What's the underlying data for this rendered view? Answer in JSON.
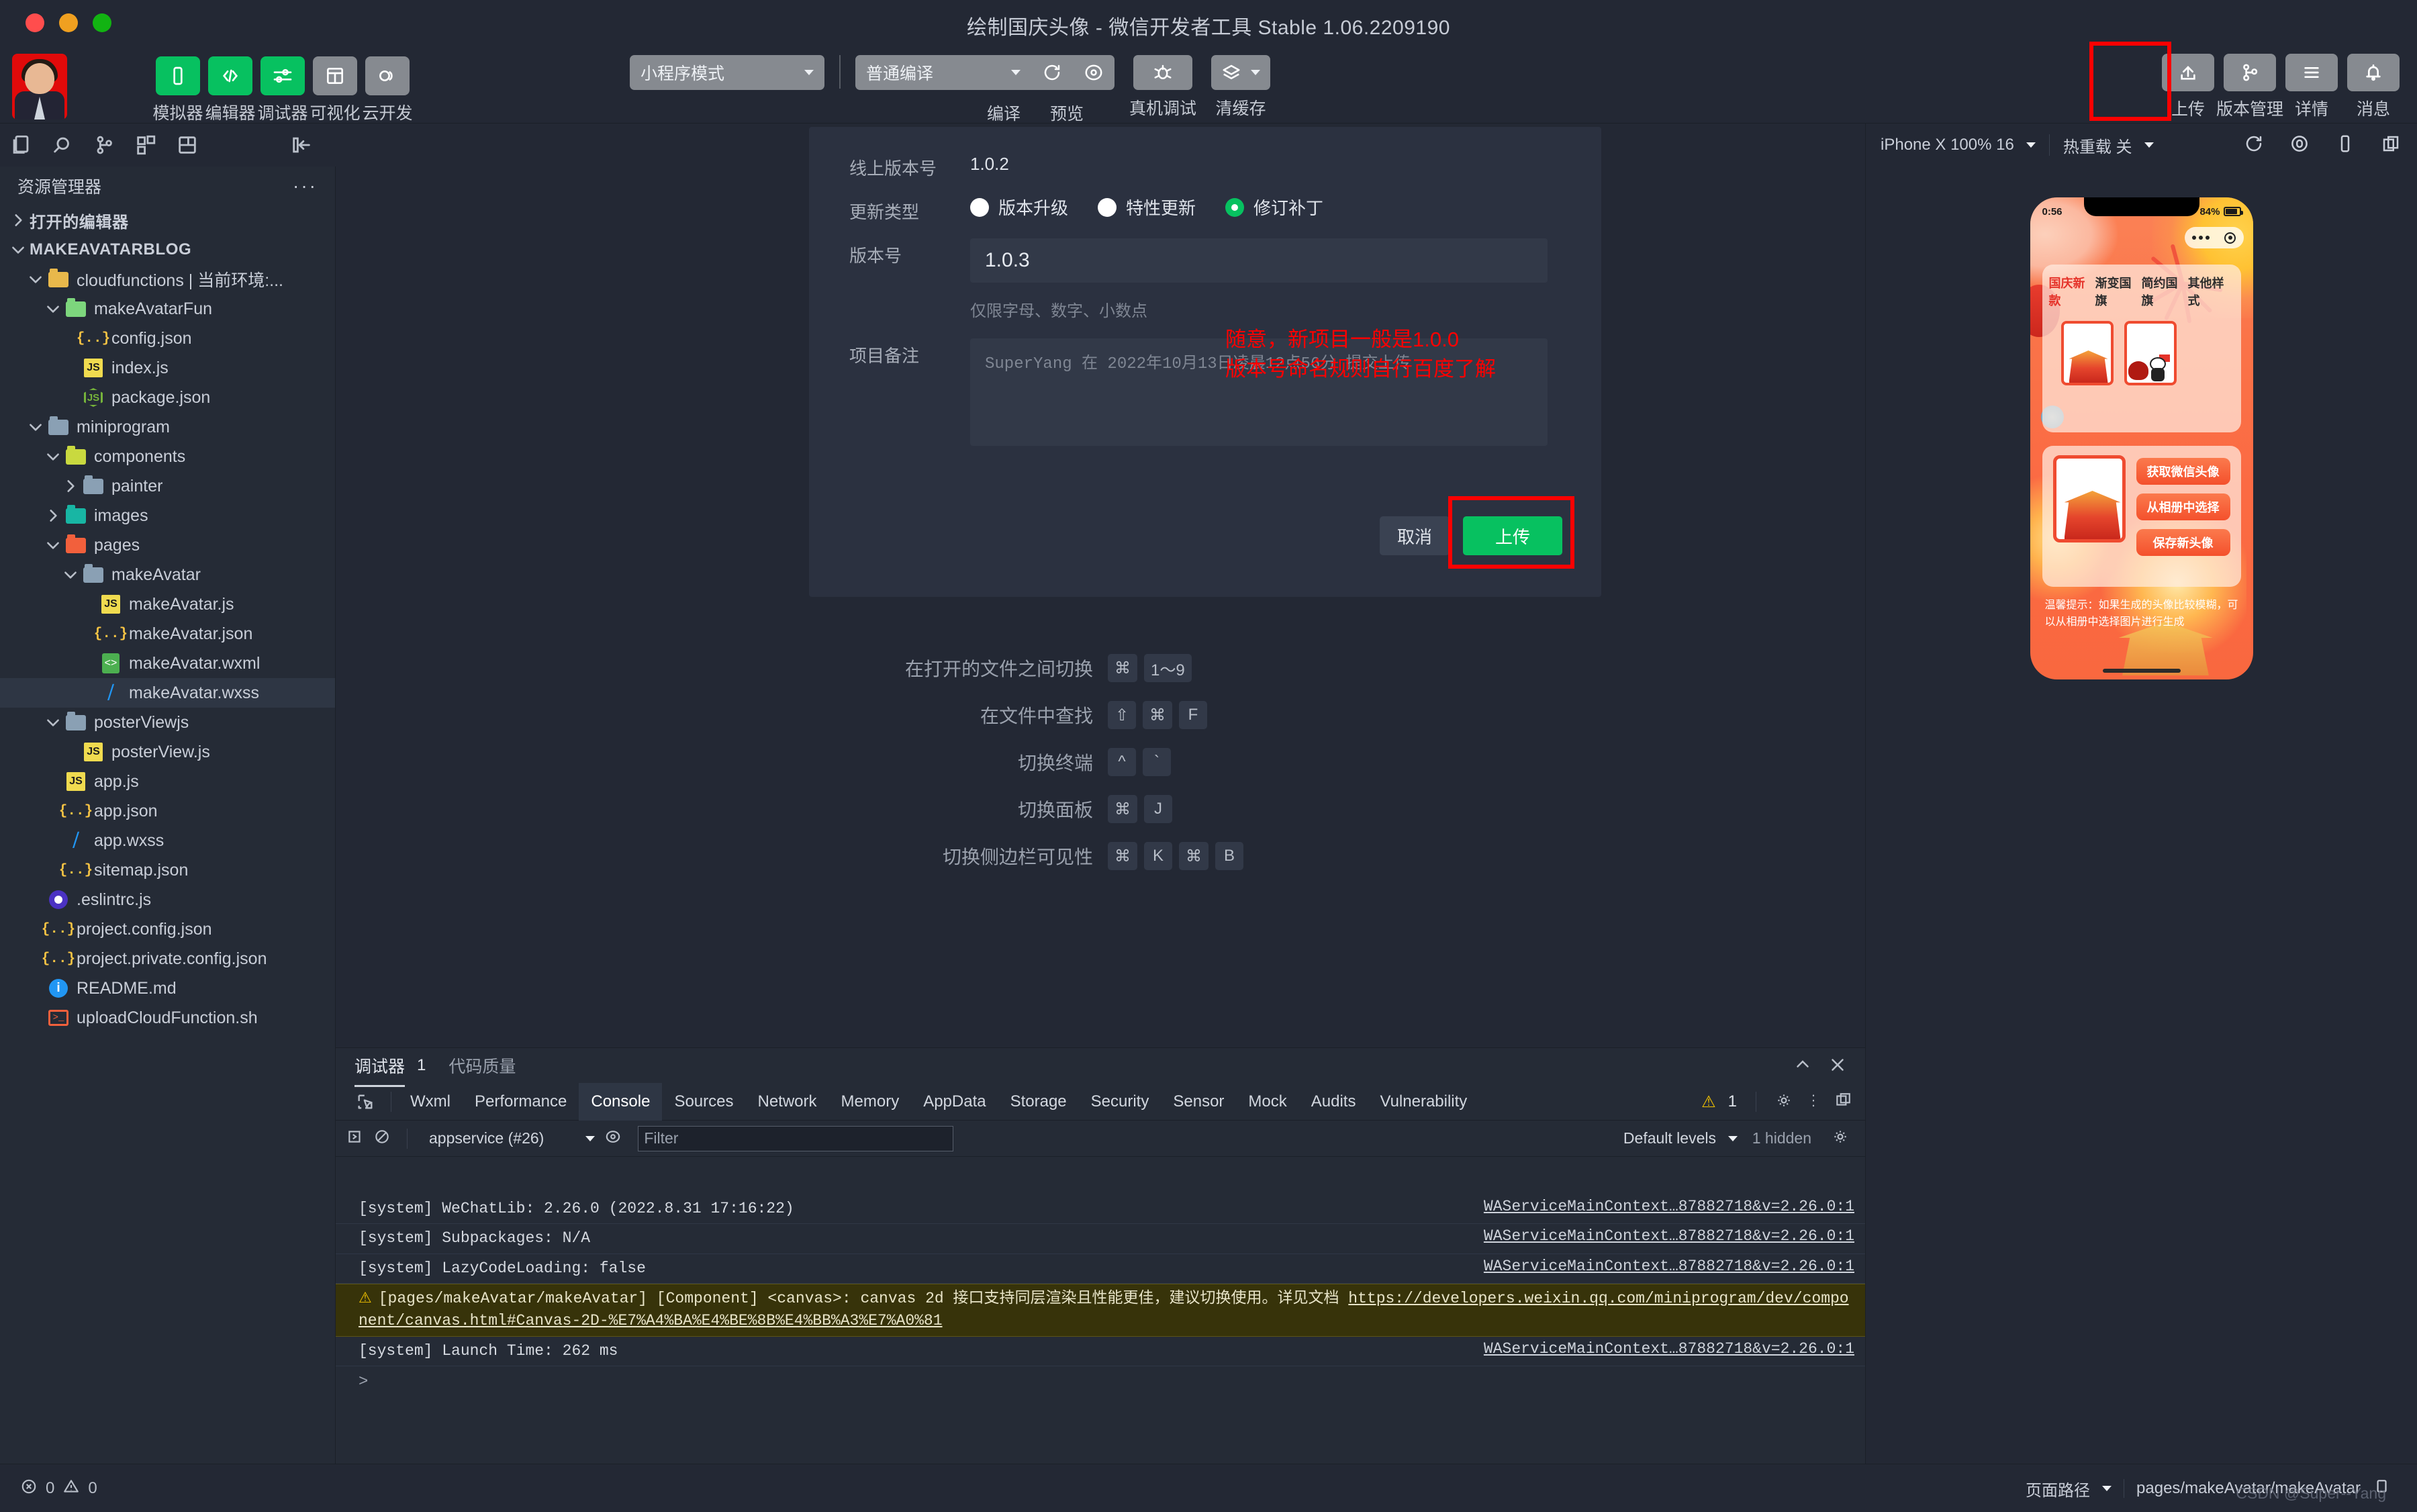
{
  "window": {
    "title": "绘制国庆头像 - 微信开发者工具 Stable 1.06.2209190"
  },
  "toolbar": {
    "left_items": [
      {
        "label": "模拟器",
        "icon": "phone-icon",
        "style": "green"
      },
      {
        "label": "编辑器",
        "icon": "code-icon",
        "style": "green"
      },
      {
        "label": "调试器",
        "icon": "sliders-icon",
        "style": "green"
      },
      {
        "label": "可视化",
        "icon": "layout-icon",
        "style": "grey"
      },
      {
        "label": "云开发",
        "icon": "cloud-icon",
        "style": "grey"
      }
    ],
    "mode_select": "小程序模式",
    "compile_select": "普通编译",
    "compile_label": "编译",
    "preview_label": "预览",
    "realdevice_label": "真机调试",
    "clearcache_label": "清缓存",
    "right_items": [
      {
        "label": "上传",
        "icon": "upload-icon"
      },
      {
        "label": "版本管理",
        "icon": "branch-icon"
      },
      {
        "label": "详情",
        "icon": "hamburger-icon"
      },
      {
        "label": "消息",
        "icon": "bell-icon"
      }
    ]
  },
  "activitybar": {
    "icons": [
      "files-icon",
      "search-icon",
      "source-control-icon",
      "extensions-icon",
      "layout-panel-icon",
      "collapse-sidebar-icon"
    ]
  },
  "explorer": {
    "title": "资源管理器",
    "more": "···",
    "open_editors": "打开的编辑器",
    "project": "MAKEAVATARBLOG",
    "tree": [
      {
        "name": "cloudfunctions | 当前环境:...",
        "indent": 1,
        "type": "folder-cloud",
        "chev": "down"
      },
      {
        "name": "makeAvatarFun",
        "indent": 2,
        "type": "folder-fn",
        "chev": "down"
      },
      {
        "name": "config.json",
        "indent": 3,
        "type": "json",
        "chev": "none"
      },
      {
        "name": "index.js",
        "indent": 3,
        "type": "js",
        "chev": "none"
      },
      {
        "name": "package.json",
        "indent": 3,
        "type": "node",
        "chev": "none"
      },
      {
        "name": "miniprogram",
        "indent": 1,
        "type": "folder",
        "chev": "down"
      },
      {
        "name": "components",
        "indent": 2,
        "type": "folder-comp",
        "chev": "down"
      },
      {
        "name": "painter",
        "indent": 3,
        "type": "folder",
        "chev": "right"
      },
      {
        "name": "images",
        "indent": 2,
        "type": "folder-img",
        "chev": "right"
      },
      {
        "name": "pages",
        "indent": 2,
        "type": "folder-pages",
        "chev": "down"
      },
      {
        "name": "makeAvatar",
        "indent": 3,
        "type": "folder",
        "chev": "down"
      },
      {
        "name": "makeAvatar.js",
        "indent": 4,
        "type": "js",
        "chev": "none"
      },
      {
        "name": "makeAvatar.json",
        "indent": 4,
        "type": "json",
        "chev": "none"
      },
      {
        "name": "makeAvatar.wxml",
        "indent": 4,
        "type": "wxml",
        "chev": "none"
      },
      {
        "name": "makeAvatar.wxss",
        "indent": 4,
        "type": "wxss",
        "chev": "none",
        "selected": true
      },
      {
        "name": "posterViewjs",
        "indent": 2,
        "type": "folder",
        "chev": "down"
      },
      {
        "name": "posterView.js",
        "indent": 3,
        "type": "js",
        "chev": "none"
      },
      {
        "name": "app.js",
        "indent": 2,
        "type": "js",
        "chev": "none"
      },
      {
        "name": "app.json",
        "indent": 2,
        "type": "json",
        "chev": "none"
      },
      {
        "name": "app.wxss",
        "indent": 2,
        "type": "wxss",
        "chev": "none"
      },
      {
        "name": "sitemap.json",
        "indent": 2,
        "type": "json",
        "chev": "none"
      },
      {
        "name": ".eslintrc.js",
        "indent": 1,
        "type": "eslint",
        "chev": "none"
      },
      {
        "name": "project.config.json",
        "indent": 1,
        "type": "json",
        "chev": "none"
      },
      {
        "name": "project.private.config.json",
        "indent": 1,
        "type": "json",
        "chev": "none"
      },
      {
        "name": "README.md",
        "indent": 1,
        "type": "md",
        "chev": "none"
      },
      {
        "name": "uploadCloudFunction.sh",
        "indent": 1,
        "type": "sh",
        "chev": "none"
      }
    ]
  },
  "dialog": {
    "online_version_label": "线上版本号",
    "online_version_value": "1.0.2",
    "update_type_label": "更新类型",
    "update_types": [
      {
        "label": "版本升级",
        "selected": false
      },
      {
        "label": "特性更新",
        "selected": false
      },
      {
        "label": "修订补丁",
        "selected": true
      }
    ],
    "version_label": "版本号",
    "version_value": "1.0.3",
    "version_hint": "仅限字母、数字、小数点",
    "memo_label": "项目备注",
    "memo_placeholder": "SuperYang 在 2022年10月13日凌晨12点56分 提交上传",
    "cancel_label": "取消",
    "upload_label": "上传",
    "annotation_line1": "随意，新项目一般是1.0.0",
    "annotation_line2": "版本号命名规则自行百度了解",
    "annotation_color": "#ff0000"
  },
  "shortcuts": [
    {
      "label": "在打开的文件之间切换",
      "keys": [
        "⌘",
        "1～9"
      ]
    },
    {
      "label": "在文件中查找",
      "keys": [
        "⇧",
        "⌘",
        "F"
      ]
    },
    {
      "label": "切换终端",
      "keys": [
        "^",
        "`"
      ]
    },
    {
      "label": "切换面板",
      "keys": [
        "⌘",
        "J"
      ]
    },
    {
      "label": "切换侧边栏可见性",
      "keys": [
        "⌘",
        "K",
        "⌘",
        "B"
      ]
    }
  ],
  "console": {
    "panel_tab": "调试器",
    "panel_badge": "1",
    "panel_tab_alt": "代码质量",
    "devtools_tabs": [
      "Wxml",
      "Performance",
      "Console",
      "Sources",
      "Network",
      "Memory",
      "AppData",
      "Storage",
      "Security",
      "Sensor",
      "Mock",
      "Audits",
      "Vulnerability"
    ],
    "active_tab": "Console",
    "warning_count": "1",
    "context": "appservice (#26)",
    "filter_placeholder": "Filter",
    "levels": "Default levels",
    "hidden_count": "1 hidden",
    "prompt": ">",
    "logs": [
      {
        "text": "[system] WeChatLib: 2.26.0 (2022.8.31 17:16:22)",
        "source": "WAServiceMainContext…87882718&v=2.26.0:1",
        "level": "info"
      },
      {
        "text": "[system] Subpackages: N/A",
        "source": "WAServiceMainContext…87882718&v=2.26.0:1",
        "level": "info"
      },
      {
        "text": "[system] LazyCodeLoading: false",
        "source": "WAServiceMainContext…87882718&v=2.26.0:1",
        "level": "info"
      },
      {
        "text": "[pages/makeAvatar/makeAvatar] [Component] <canvas>: canvas 2d 接口支持同层渲染且性能更佳，建议切换使用。详见文档 ",
        "link": "https://developers.weixin.qq.com/miniprogram/dev/component/canvas.html#Canvas-2D-%E7%A4%BA%E4%BE%8B%E4%BB%A3%E7%A0%81",
        "source": "",
        "level": "warn"
      },
      {
        "text": "[system] Launch Time: 262 ms",
        "source": "WAServiceMainContext…87882718&v=2.26.0:1",
        "level": "info"
      }
    ]
  },
  "simulator": {
    "device_select": "iPhone X 100% 16",
    "hotreload_select": "热重载 关",
    "icons": [
      "refresh-icon",
      "record-icon",
      "device-icon",
      "multi-window-icon"
    ],
    "phone": {
      "time": "0:56",
      "battery": "84%",
      "tabs": [
        {
          "label": "国庆新款",
          "active": true
        },
        {
          "label": "渐变国旗",
          "active": false
        },
        {
          "label": "简约国旗",
          "active": false
        },
        {
          "label": "其他样式",
          "active": false
        }
      ],
      "buttons": [
        "获取微信头像",
        "从相册中选择",
        "保存新头像"
      ],
      "tip": "温馨提示：如果生成的头像比较模糊，可以从相册中选择图片进行生成"
    }
  },
  "statusbar": {
    "errors": "0",
    "warnings": "0",
    "page_path_label": "页面路径",
    "page_path": "pages/makeAvatar/makeAvatar",
    "watermark": "CSDN @Super--Yang"
  }
}
